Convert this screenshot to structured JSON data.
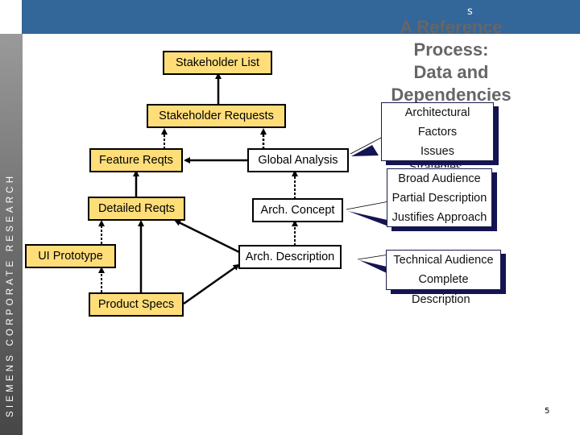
{
  "header": {
    "letter": "s"
  },
  "sidebar": {
    "brand_text": "SIEMENS CORPORATE RESEARCH"
  },
  "title": {
    "lines": [
      "A Reference",
      "Process:",
      "Data and",
      "Dependencies"
    ]
  },
  "nodes": {
    "stakeholder_list": "Stakeholder List",
    "stakeholder_requests": "Stakeholder Requests",
    "feature_reqts": "Feature Reqts",
    "global_analysis": "Global Analysis",
    "detailed_reqts": "Detailed Reqts",
    "arch_concept": "Arch. Concept",
    "ui_prototype": "UI Prototype",
    "arch_description": "Arch. Description",
    "product_specs": "Product Specs"
  },
  "callouts": {
    "global_analysis": {
      "lines": [
        "Architectural",
        "Factors",
        "Issues"
      ],
      "hidden_overflow": "Strategies"
    },
    "arch_concept": {
      "lines": [
        "Broad Audience",
        "Partial Description",
        "Justifies Approach"
      ]
    },
    "arch_description": {
      "lines": [
        "Technical Audience",
        "Complete"
      ],
      "overflow": "Description"
    }
  },
  "edges": [
    {
      "from": "Stakeholder Requests",
      "to": "Stakeholder List",
      "style": "solid"
    },
    {
      "from": "Feature Reqts",
      "to": "Stakeholder Requests",
      "style": "dashed"
    },
    {
      "from": "Global Analysis",
      "to": "Stakeholder Requests",
      "style": "dashed"
    },
    {
      "from": "Global Analysis",
      "to": "Feature Reqts",
      "style": "solid"
    },
    {
      "from": "Detailed Reqts",
      "to": "Feature Reqts",
      "style": "solid"
    },
    {
      "from": "Arch. Concept",
      "to": "Global Analysis",
      "style": "dashed"
    },
    {
      "from": "UI Prototype",
      "to": "Detailed Reqts",
      "style": "dashed"
    },
    {
      "from": "Product Specs",
      "to": "Detailed Reqts",
      "style": "solid"
    },
    {
      "from": "Arch. Description",
      "to": "Detailed Reqts",
      "style": "solid"
    },
    {
      "from": "Arch. Description",
      "to": "Arch. Concept",
      "style": "dashed"
    },
    {
      "from": "Product Specs",
      "to": "UI Prototype",
      "style": "dashed"
    },
    {
      "from": "Product Specs",
      "to": "Arch. Description",
      "style": "solid"
    }
  ],
  "footer": {
    "page_number": "5"
  },
  "colors": {
    "header": "#336699",
    "requirement_box": "#ffde7a",
    "architecture_box": "#ffffff",
    "callout_shadow": "#141452",
    "title": "#666666"
  }
}
